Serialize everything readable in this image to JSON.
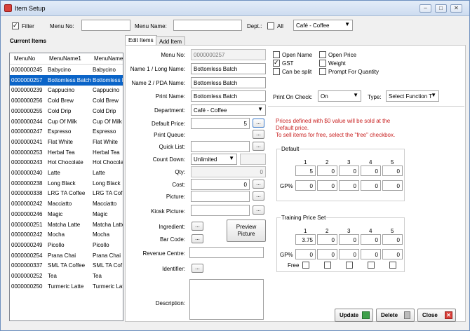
{
  "window": {
    "title": "Item Setup"
  },
  "filterbar": {
    "filter_label": "Filter",
    "menu_no_label": "Menu No:",
    "menu_no_value": "",
    "menu_name_label": "Menu Name:",
    "menu_name_value": "",
    "dept_label": "Dept.:",
    "all_label": "All",
    "dept_value": "Café - Coffee"
  },
  "list": {
    "title": "Current Items",
    "headers": [
      "MenuNo",
      "MenuName1",
      "MenuName"
    ],
    "rows": [
      [
        "0000000245",
        "Babycino",
        "Babycino"
      ],
      [
        "0000000257",
        "Bottomless Batch",
        "Bottomless B"
      ],
      [
        "0000000239",
        "Cappucino",
        "Cappucino"
      ],
      [
        "0000000256",
        "Cold Brew",
        "Cold Brew"
      ],
      [
        "0000000255",
        "Cold Drip",
        "Cold Drip"
      ],
      [
        "0000000244",
        "Cup Of Milk",
        "Cup Of Milk"
      ],
      [
        "0000000247",
        "Espresso",
        "Espresso"
      ],
      [
        "0000000241",
        "Flat White",
        "Flat White"
      ],
      [
        "0000000253",
        "Herbal Tea",
        "Herbal Tea"
      ],
      [
        "0000000243",
        "Hot Chocolate",
        "Hot Chocola"
      ],
      [
        "0000000240",
        "Latte",
        "Latte"
      ],
      [
        "0000000238",
        "Long Black",
        "Long Black"
      ],
      [
        "0000000338",
        "LRG TA Coffee",
        "LRG TA Cof"
      ],
      [
        "0000000242",
        "Macciatto",
        "Macciatto"
      ],
      [
        "0000000246",
        "Magic",
        "Magic"
      ],
      [
        "0000000251",
        "Matcha Latte",
        "Matcha Latte"
      ],
      [
        "0000000242",
        "Mocha",
        "Mocha"
      ],
      [
        "0000000249",
        "Picollo",
        "Picollo"
      ],
      [
        "0000000254",
        "Prana Chai",
        "Prana Chai"
      ],
      [
        "0000000337",
        "SML TA Coffee",
        "SML TA Cof"
      ],
      [
        "0000000252",
        "Tea",
        "Tea"
      ],
      [
        "0000000250",
        "Turmeric Latte",
        "Turmeric Lat"
      ]
    ],
    "selected_index": 1
  },
  "tabs": {
    "edit": "Edit Items",
    "add": "Add Item"
  },
  "form": {
    "menu_no_label": "Menu No:",
    "menu_no": "0000000257",
    "name1_label": "Name 1 / Long Name:",
    "name1": "Bottomless Batch",
    "name2_label": "Name 2 / PDA Name:",
    "name2": "Bottomless Batch",
    "print_label": "Print Name:",
    "print": "Bottomless Batch",
    "dept_label": "Department:",
    "dept": "Café - Coffee",
    "price_label": "Default Price:",
    "price": "5",
    "queue_label": "Print Queue:",
    "quick_label": "Quick List:",
    "count_label": "Count Down:",
    "count": "Unlimited",
    "qty_label": "Qty:",
    "qty": "0",
    "cost_label": "Cost:",
    "cost": "0",
    "picture_label": "Picture:",
    "kiosk_label": "Kiosk Picture:",
    "ingredient_label": "Ingredient:",
    "barcode_label": "Bar Code:",
    "preview_label": "Preview Picture",
    "revenue_label": "Revenue Centre:",
    "identifier_label": "Identifier:",
    "description_label": "Description:",
    "ellipsis": "..."
  },
  "options": {
    "open_name": "Open Name",
    "gst": "GST",
    "split": "Can be split",
    "open_price": "Open Price",
    "weight": "Weight",
    "prompt_qty": "Prompt For Quantity",
    "print_on_check_label": "Print On Check:",
    "print_on_check": "On",
    "type_label": "Type:",
    "type": "Select Function T"
  },
  "notice": {
    "line1": "Prices defined with $0 value will be sold at the",
    "line2": "Default price.",
    "line3": "To sell items for free, select the \"free\" checkbox."
  },
  "default_group": {
    "title": "Default",
    "cols": [
      "1",
      "2",
      "3",
      "4",
      "5"
    ],
    "prices": [
      "5",
      "0",
      "0",
      "0",
      "0"
    ],
    "gp_label": "GP%",
    "gp": [
      "0",
      "0",
      "0",
      "0",
      "0"
    ]
  },
  "training_group": {
    "title": "Training Price Set",
    "cols": [
      "1",
      "2",
      "3",
      "4",
      "5"
    ],
    "prices": [
      "3.75",
      "0",
      "0",
      "0",
      "0"
    ],
    "gp_label": "GP%",
    "gp": [
      "0",
      "0",
      "0",
      "0",
      "0"
    ],
    "free_label": "Free"
  },
  "buttons": {
    "update": "Update",
    "delete": "Delete",
    "close": "Close"
  }
}
